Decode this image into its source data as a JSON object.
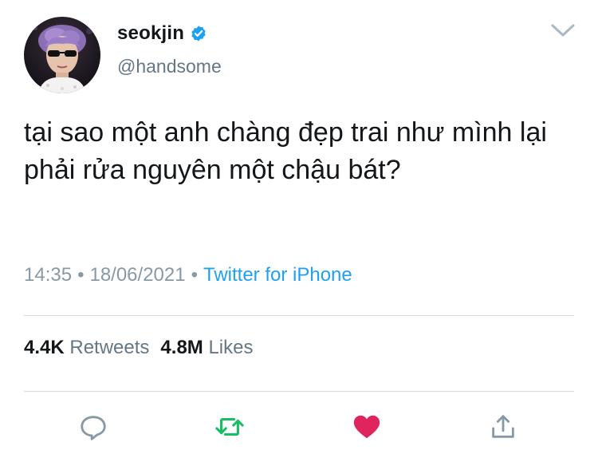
{
  "user": {
    "display_name": "seokjin",
    "handle": "@handsome",
    "verified": true
  },
  "tweet": {
    "text": "tại sao một anh chàng đẹp trai như mình lại phải rửa nguyên một chậu bát?"
  },
  "meta": {
    "time": "14:35",
    "separator": "•",
    "date": "18/06/2021",
    "source": "Twitter for iPhone"
  },
  "stats": {
    "retweets_count": "4.4K",
    "retweets_label": "Retweets",
    "likes_count": "4.8M",
    "likes_label": "Likes"
  },
  "actions": {
    "reply_icon": "reply-icon",
    "retweet_icon": "retweet-icon",
    "like_icon": "heart-icon",
    "share_icon": "share-icon",
    "liked": true
  },
  "colors": {
    "link": "#1da1f2",
    "verified": "#1da1f2",
    "retweet": "#17bf63",
    "like": "#e0245e",
    "muted": "#657786"
  }
}
